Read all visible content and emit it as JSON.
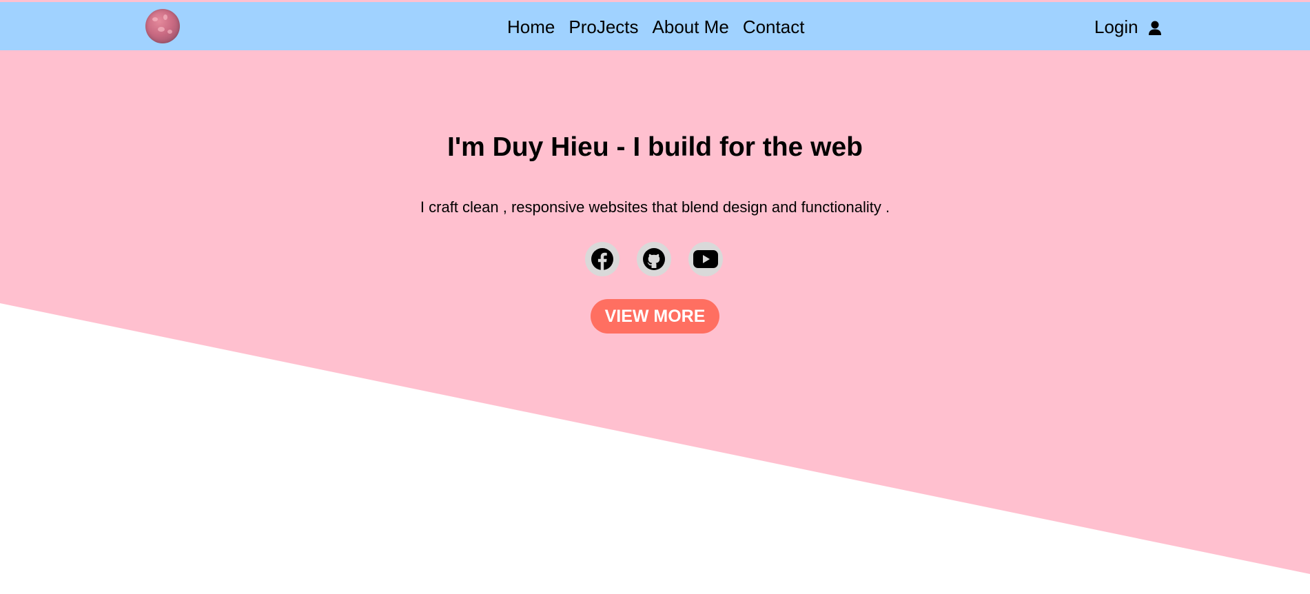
{
  "colors": {
    "header_bg": "#a0d2ff",
    "hero_bg": "#ffc0cf",
    "accent": "#ff6f61",
    "icon_circle": "#d9d9d9"
  },
  "header": {
    "avatar_icon": "avatar-image",
    "nav": [
      {
        "label": "Home"
      },
      {
        "label": "ProJects"
      },
      {
        "label": "About Me"
      },
      {
        "label": "Contact"
      }
    ],
    "login_label": "Login",
    "login_icon": "user-icon"
  },
  "hero": {
    "title": "I'm Duy Hieu - I build for the web",
    "subtitle": "I craft clean , responsive websites that blend design and functionality .",
    "socials": [
      {
        "icon": "facebook-icon"
      },
      {
        "icon": "github-icon"
      },
      {
        "icon": "youtube-icon"
      }
    ],
    "cta_label": "VIEW MORE"
  }
}
